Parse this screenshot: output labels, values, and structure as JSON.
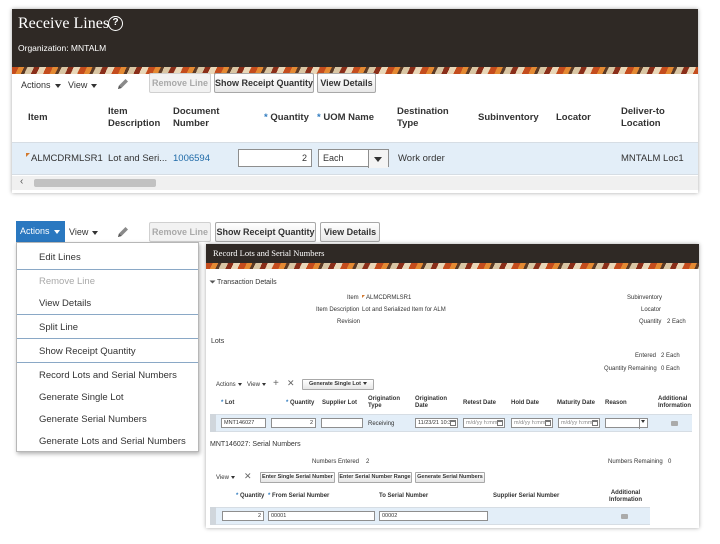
{
  "top": {
    "title": "Receive Lines",
    "organization": "Organization: MNTALM",
    "toolbar": {
      "actions": "Actions",
      "view": "View",
      "remove_line": "Remove Line",
      "show_receipt_quantity": "Show Receipt Quantity",
      "view_details": "View Details"
    },
    "columns": {
      "item": "Item",
      "item_desc_1": "Item",
      "item_desc_2": "Description",
      "doc_1": "Document",
      "doc_2": "Number",
      "quantity": "Quantity",
      "uom": "UOM Name",
      "dest_1": "Destination",
      "dest_2": "Type",
      "subinventory": "Subinventory",
      "locator": "Locator",
      "deliver_1": "Deliver-to",
      "deliver_2": "Location"
    },
    "row": {
      "item": "ALMCDRMLSR1",
      "item_description": "Lot and Seri...",
      "document_number": "1006594",
      "quantity": "2",
      "uom": "Each",
      "destination_type": "Work order",
      "deliver_to": "MNTALM Loc1"
    }
  },
  "bottom_toolbar": {
    "actions": "Actions",
    "view": "View",
    "remove_line": "Remove Line",
    "show_receipt_quantity": "Show Receipt Quantity",
    "view_details": "View Details"
  },
  "menu": {
    "items": [
      "Edit Lines",
      "Remove Line",
      "View Details",
      "Split Line",
      "Show Receipt Quantity",
      "Record Lots and Serial Numbers",
      "Generate Single Lot",
      "Generate Serial Numbers",
      "Generate Lots and Serial Numbers"
    ]
  },
  "record": {
    "title": "Record Lots and Serial Numbers",
    "transaction_details": "Transaction Details",
    "item_label": "Item",
    "item_value": "ALMCDRMLSR1",
    "item_desc_label": "Item Description",
    "item_desc_value": "Lot and Serialized Item for ALM",
    "revision_label": "Revision",
    "subinventory_label": "Subinventory",
    "locator_label": "Locator",
    "quantity_label": "Quantity",
    "quantity_value": "2 Each",
    "lots_title": "Lots",
    "entered_label": "Entered",
    "entered_value": "2 Each",
    "qty_remaining_label": "Quantity Remaining",
    "qty_remaining_value": "0 Each",
    "lots_toolbar": {
      "actions": "Actions",
      "view": "View",
      "generate_single_lot": "Generate Single Lot"
    },
    "lots_columns": {
      "lot": "Lot",
      "quantity": "Quantity",
      "supplier_lot": "Supplier Lot",
      "orig_type_1": "Origination",
      "orig_type_2": "Type",
      "orig_date_1": "Origination",
      "orig_date_2": "Date",
      "retest_date": "Retest Date",
      "hold_date": "Hold Date",
      "maturity_date": "Maturity Date",
      "reason": "Reason",
      "addl_1": "Additional",
      "addl_2": "Information"
    },
    "lots_row": {
      "lot": "MNT146027",
      "quantity": "2",
      "origination_type": "Receiving",
      "origination_date": "11/23/21 10:3",
      "date_placeholder": "m/d/yy h:mm"
    },
    "serial_title": "MNT146027: Serial Numbers",
    "numbers_entered_label": "Numbers Entered",
    "numbers_entered_value": "2",
    "numbers_remaining_label": "Numbers Remaining",
    "numbers_remaining_value": "0",
    "serial_toolbar": {
      "view": "View",
      "enter_single": "Enter Single Serial Number",
      "enter_range": "Enter Serial Number Range",
      "generate": "Generate Serial Numbers"
    },
    "serial_columns": {
      "quantity": "Quantity",
      "from": "From Serial Number",
      "to": "To Serial Number",
      "supplier": "Supplier Serial Number",
      "addl_1": "Additional",
      "addl_2": "Information"
    },
    "serial_row": {
      "quantity": "2",
      "from": "00001",
      "to": "00002"
    }
  }
}
